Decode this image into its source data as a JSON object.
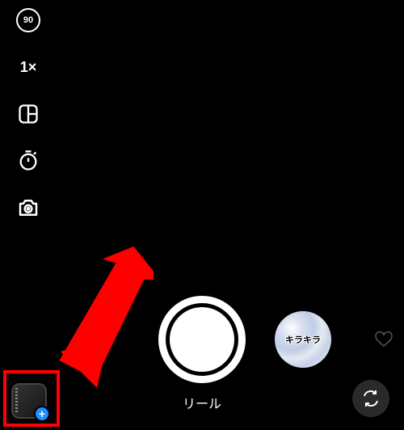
{
  "tools": {
    "duration": "90",
    "zoom": "1×"
  },
  "effects": {
    "glitter_label": "キラキラ"
  },
  "mode_label": "リール",
  "gallery_plus": "+",
  "colors": {
    "highlight": "#ff0000",
    "accent_blue": "#1e90ff"
  }
}
